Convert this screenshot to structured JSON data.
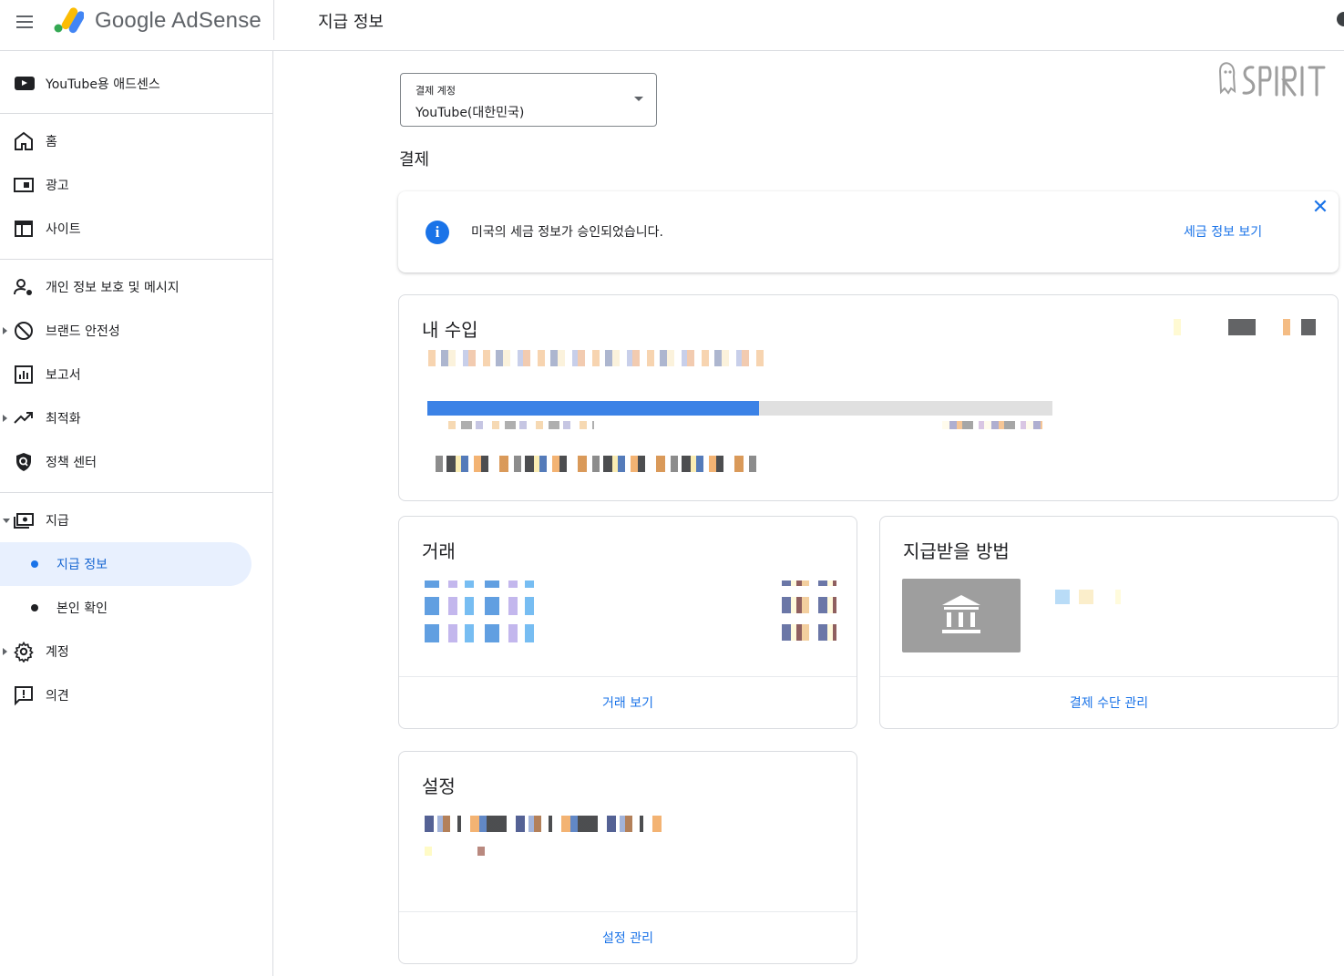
{
  "header": {
    "app_name": "Google AdSense",
    "page_title": "지급 정보",
    "menu_icon": "hamburger-menu-icon",
    "logo_colors": [
      "#fbbc04",
      "#34a853",
      "#4285f4"
    ]
  },
  "sidebar": {
    "top_item": {
      "label": "YouTube용 애드센스",
      "icon": "youtube-icon"
    },
    "items": [
      {
        "label": "홈",
        "icon": "home-icon"
      },
      {
        "label": "광고",
        "icon": "ads-icon"
      },
      {
        "label": "사이트",
        "icon": "sites-icon"
      },
      {
        "label": "개인 정보 보호 및 메시지",
        "icon": "privacy-messaging-icon"
      },
      {
        "label": "브랜드 안전성",
        "icon": "block-icon"
      },
      {
        "label": "보고서",
        "icon": "reports-icon"
      },
      {
        "label": "최적화",
        "icon": "trending-icon"
      },
      {
        "label": "정책 센터",
        "icon": "policy-shield-icon"
      },
      {
        "label": "지급",
        "icon": "payments-icon"
      },
      {
        "label": "지급 정보",
        "icon": ""
      },
      {
        "label": "본인 확인",
        "icon": ""
      },
      {
        "label": "계정",
        "icon": "gear-icon"
      },
      {
        "label": "의견",
        "icon": "feedback-icon"
      }
    ],
    "active_color": "#1967d2"
  },
  "main": {
    "account_select": {
      "label": "결제 계정",
      "value": "YouTube(대한민국)"
    },
    "section_title": "결제",
    "notice": {
      "text": "미국의 세금 정보가 승인되었습니다.",
      "link": "세금 정보 보기",
      "close_icon": "close-icon"
    },
    "earnings": {
      "title": "내 수입",
      "progress": 0.53
    },
    "transactions": {
      "title": "거래",
      "link": "거래 보기"
    },
    "payment_method": {
      "title": "지급받을 방법",
      "link": "결제 수단 관리",
      "icon": "bank-icon"
    },
    "settings": {
      "title": "설정",
      "link": "설정 관리"
    },
    "accent_color": "#1a73e8"
  }
}
